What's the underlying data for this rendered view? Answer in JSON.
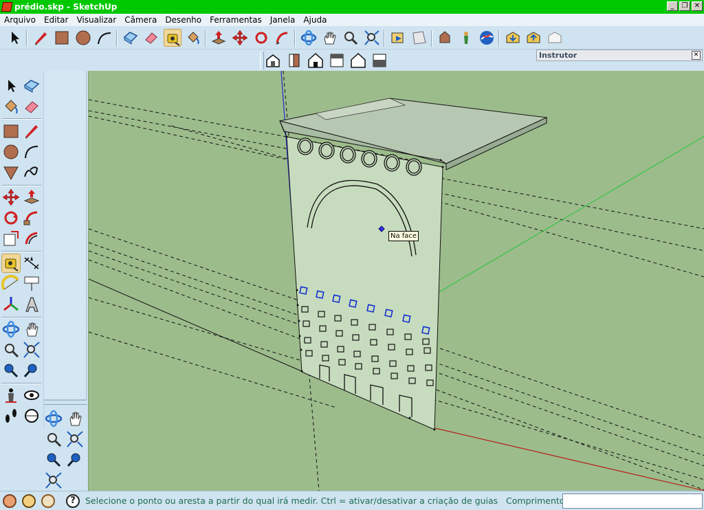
{
  "window": {
    "title": "prédio.skp - SketchUp",
    "buttons": {
      "minimize": "_",
      "maximize": "❐",
      "close": "✕"
    }
  },
  "menu": [
    "Arquivo",
    "Editar",
    "Visualizar",
    "Câmera",
    "Desenho",
    "Ferramentas",
    "Janela",
    "Ajuda"
  ],
  "panels": {
    "instructor": {
      "title": "Instrutor",
      "close": "✕"
    }
  },
  "viewport": {
    "inference_tooltip": "Na face"
  },
  "status": {
    "message": "Selecione o ponto ou aresta a partir do qual irá medir. Ctrl = ativar/desativar a criação de guias",
    "measurement_label": "Comprimento",
    "measurement_value": ""
  },
  "colors": {
    "titlebar": "#00c800",
    "viewport_bg": "#9dbc8c",
    "toolbar_bg": "#cfe3f0",
    "status_text": "#1f6c52",
    "blue_axis": "#2a33c9",
    "green_axis": "#23c43a",
    "red_axis": "#b22a20",
    "selection_blue": "#1430d0"
  },
  "toolbar_icons": [
    "select-icon",
    "pencil-icon",
    "rectangle-icon",
    "circle-icon",
    "arc-icon",
    "make-component-icon",
    "eraser-icon",
    "tape-measure-icon",
    "paint-bucket-icon",
    "push-pull-icon",
    "move-icon",
    "rotate-icon",
    "follow-me-icon",
    "orbit-icon",
    "pan-icon",
    "zoom-icon",
    "zoom-extents-icon",
    "get-models-icon",
    "share-model-icon",
    "component-icon",
    "position-camera-icon",
    "google-earth-icon",
    "3d-warehouse-get-icon",
    "3d-warehouse-share-icon",
    "share-component-icon"
  ],
  "view_icons": [
    "iso-view-icon",
    "front-view-icon",
    "top-view-icon",
    "right-view-icon",
    "back-view-icon",
    "left-view-icon"
  ]
}
